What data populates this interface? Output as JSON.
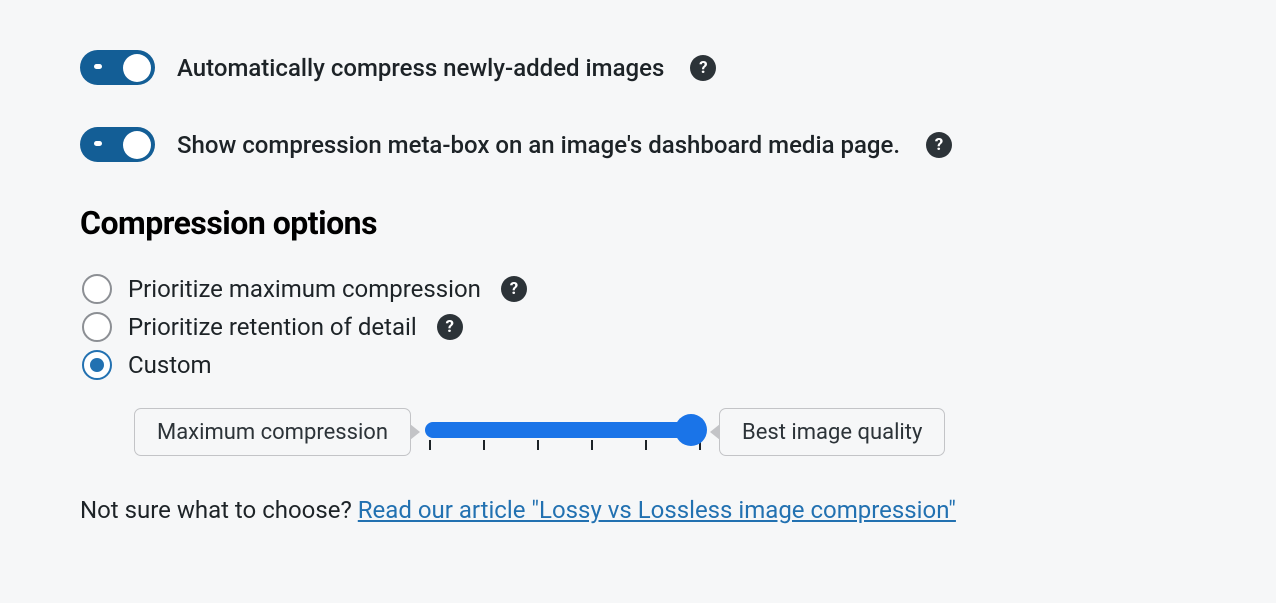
{
  "toggles": {
    "autoCompress": "Automatically compress newly-added images",
    "showMetaBox": "Show compression meta-box on an image's dashboard media page."
  },
  "section": {
    "title": "Compression options"
  },
  "radios": {
    "maxCompression": "Prioritize maximum compression",
    "retainDetail": "Prioritize retention of detail",
    "custom": "Custom"
  },
  "slider": {
    "leftLabel": "Maximum compression",
    "rightLabel": "Best image quality"
  },
  "helpText": {
    "prefix": "Not sure what to choose? ",
    "linkText": "Read our article \"Lossy vs Lossless image compression\""
  }
}
